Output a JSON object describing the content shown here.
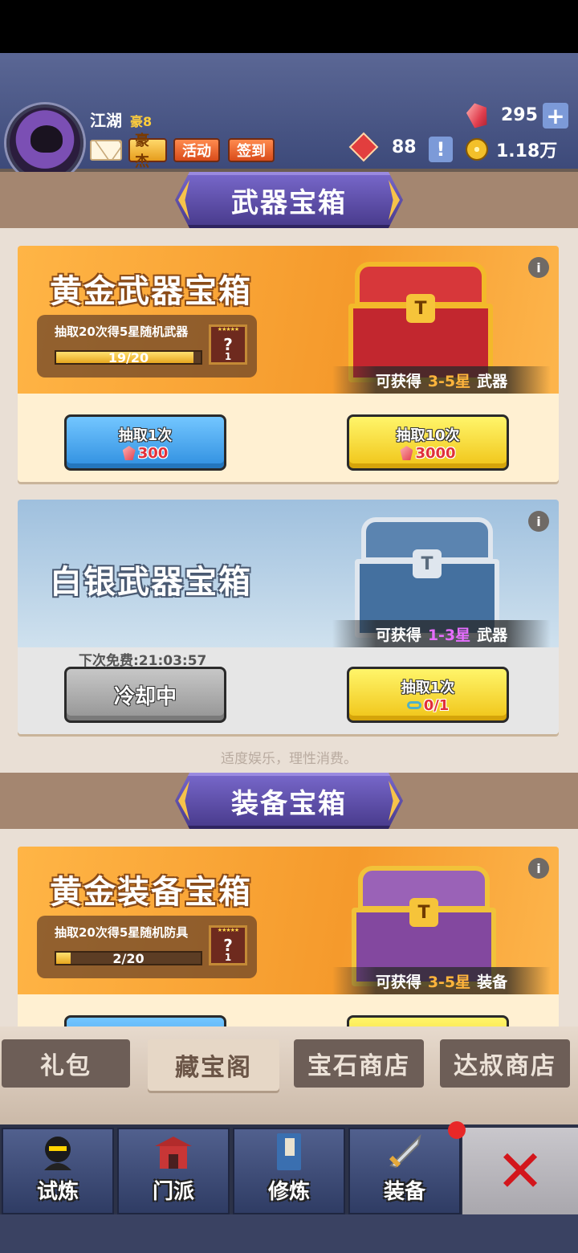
{
  "player": {
    "name": "江湖",
    "vip": "豪8"
  },
  "header_buttons": {
    "haojie": "豪杰",
    "huodong": "活动",
    "qiandao": "签到"
  },
  "resources": {
    "gems": "295",
    "honor": "88",
    "coins": "1.18万"
  },
  "sections": {
    "weapon": "武器宝箱",
    "equipment": "装备宝箱"
  },
  "gold_weapon": {
    "title": "黄金武器宝箱",
    "progress_label": "抽取20次得5星随机武器",
    "progress_text": "19/20",
    "progress_fraction": 0.95,
    "reward_count": "1",
    "obtain_prefix": "可获得",
    "obtain_range": "3-5星",
    "obtain_suffix": "武器",
    "btn1_label": "抽取1次",
    "btn1_cost": "300",
    "btn10_label": "抽取10次",
    "btn10_cost": "3000"
  },
  "silver_weapon": {
    "title": "白银武器宝箱",
    "obtain_prefix": "可获得",
    "obtain_range": "1-3星",
    "obtain_suffix": "武器",
    "free_timer": "下次免费:21:03:57",
    "cooldown_label": "冷却中",
    "btn1_label": "抽取1次",
    "btn1_cost": "0/1"
  },
  "notice": "适度娱乐，理性消费。",
  "gold_equip": {
    "title": "黄金装备宝箱",
    "progress_label": "抽取20次得5星随机防具",
    "progress_text": "2/20",
    "progress_fraction": 0.1,
    "reward_count": "1",
    "obtain_prefix": "可获得",
    "obtain_range": "3-5星",
    "obtain_suffix": "装备"
  },
  "shop_tabs": [
    "礼包",
    "藏宝阁",
    "宝石商店",
    "达叔商店"
  ],
  "nav": [
    "试炼",
    "门派",
    "修炼",
    "装备"
  ],
  "colors": {
    "accent_gold": "#ffb43c",
    "accent_purple": "#e66dff",
    "active_tab": "藏宝阁"
  }
}
